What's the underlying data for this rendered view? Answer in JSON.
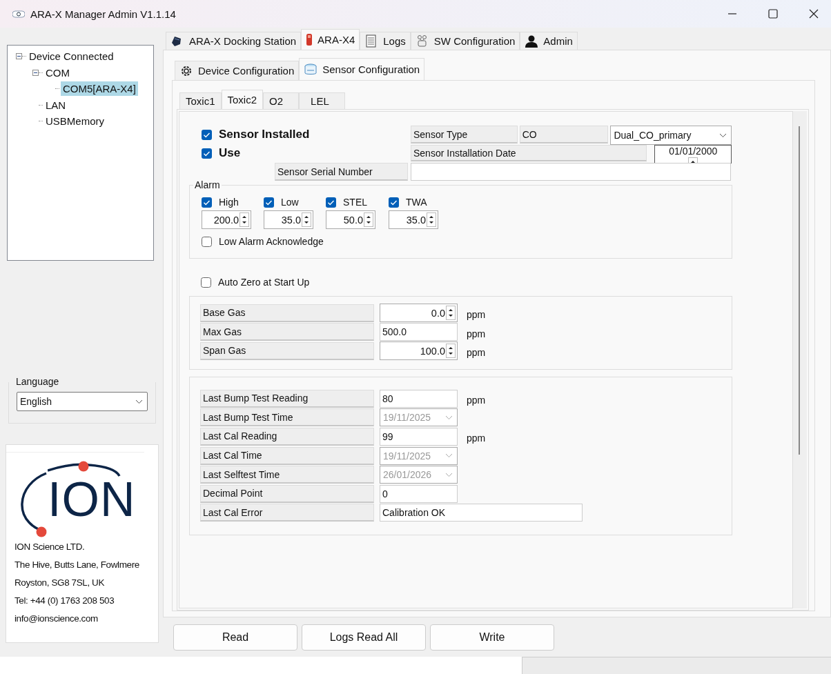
{
  "window": {
    "title": "ARA-X Manager Admin V1.1.14"
  },
  "tree": [
    {
      "label": "Device Connected",
      "selected": false,
      "expanded": true,
      "children": [
        {
          "label": "COM",
          "selected": false,
          "expanded": true,
          "children": [
            {
              "label": "COM5[ARA-X4]",
              "selected": true
            }
          ]
        },
        {
          "label": "LAN",
          "selected": false
        },
        {
          "label": "USBMemory",
          "selected": false
        }
      ]
    }
  ],
  "language": {
    "label": "Language",
    "value": "English"
  },
  "company": {
    "logo_text": "ION",
    "lines": [
      "ION Science LTD.",
      "The Hive, Butts Lane, Fowlmere",
      "Royston, SG8 7SL, UK",
      "Tel: +44 (0) 1763 208 503",
      "info@ionscience.com"
    ]
  },
  "main_tabs": [
    {
      "label": "ARA-X Docking Station",
      "selected": false
    },
    {
      "label": "ARA-X4",
      "selected": true
    },
    {
      "label": "Logs",
      "selected": false
    },
    {
      "label": "SW Configuration",
      "selected": false
    },
    {
      "label": "Admin",
      "selected": false
    }
  ],
  "sub_tabs": [
    {
      "label": "Device Configuration",
      "selected": false
    },
    {
      "label": "Sensor Configuration",
      "selected": true
    }
  ],
  "sensor_tabs": [
    {
      "label": "Toxic1",
      "selected": false
    },
    {
      "label": "Toxic2",
      "selected": true
    },
    {
      "label": "O2",
      "selected": false
    },
    {
      "label": "LEL",
      "selected": false
    }
  ],
  "sensor": {
    "installed": {
      "label": "Sensor Installed",
      "checked": true
    },
    "use": {
      "label": "Use",
      "checked": true
    },
    "type_label": "Sensor Type",
    "type_value": "CO",
    "model": "Dual_CO_primary",
    "date_label": "Sensor Installation Date",
    "date": "01/01/2000",
    "serial_label": "Sensor Serial Number"
  },
  "alarm": {
    "title": "Alarm",
    "levels": [
      {
        "label": "High",
        "checked": true,
        "value": "200.0"
      },
      {
        "label": "Low",
        "checked": true,
        "value": "35.0"
      },
      {
        "label": "STEL",
        "checked": true,
        "value": "50.0"
      },
      {
        "label": "TWA",
        "checked": true,
        "value": "35.0"
      }
    ],
    "acknowledge": {
      "label": "Low Alarm Acknowledge",
      "checked": false
    }
  },
  "auto_zero": {
    "label": "Auto Zero at Start Up",
    "checked": false
  },
  "gas": [
    {
      "label": "Base Gas",
      "kind": "spinner",
      "value": "0.0",
      "unit": "ppm"
    },
    {
      "label": "Max Gas",
      "kind": "text",
      "value": "500.0",
      "unit": "ppm"
    },
    {
      "label": "Span Gas",
      "kind": "spinner",
      "value": "100.0",
      "unit": "ppm"
    }
  ],
  "history": [
    {
      "label": "Last Bump Test Reading",
      "kind": "text",
      "value": "80",
      "unit": "ppm",
      "disabled": false
    },
    {
      "label": "Last Bump Test Time",
      "kind": "date",
      "value": "19/11/2025",
      "disabled": true
    },
    {
      "label": "Last Cal Reading",
      "kind": "text",
      "value": "99",
      "unit": "ppm",
      "disabled": false
    },
    {
      "label": "Last Cal Time",
      "kind": "date",
      "value": "19/11/2025",
      "disabled": true
    },
    {
      "label": "Last Selftest Time",
      "kind": "date",
      "value": "26/01/2026",
      "disabled": true
    },
    {
      "label": "Decimal Point",
      "kind": "text",
      "value": "0",
      "disabled": false
    },
    {
      "label": "Last Cal Error",
      "kind": "wide",
      "value": "Calibration OK",
      "disabled": false
    }
  ],
  "buttons": [
    "Read",
    "Logs Read All",
    "Write"
  ]
}
